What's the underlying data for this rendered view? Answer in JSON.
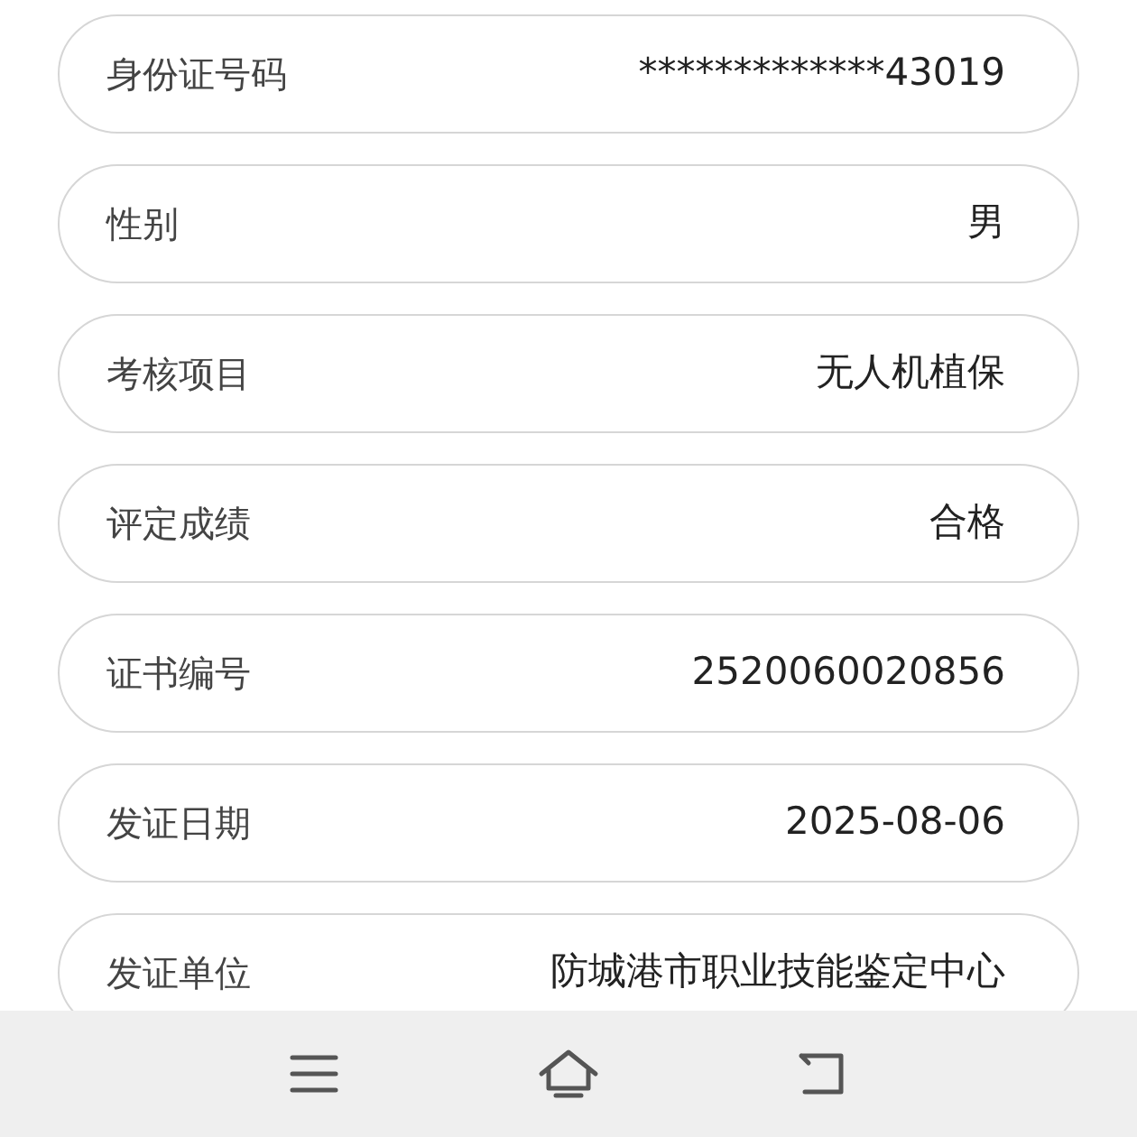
{
  "fields": [
    {
      "label": "身份证号码",
      "value": "*************43019"
    },
    {
      "label": "性别",
      "value": "男"
    },
    {
      "label": "考核项目",
      "value": "无人机植保"
    },
    {
      "label": "评定成绩",
      "value": "合格"
    },
    {
      "label": "证书编号",
      "value": "2520060020856"
    },
    {
      "label": "发证日期",
      "value": "2025-08-06"
    },
    {
      "label": "发证单位",
      "value": "防城港市职业技能鉴定中心"
    }
  ],
  "nav_bar": {
    "buttons": [
      {
        "kind": "menu"
      },
      {
        "kind": "home"
      },
      {
        "kind": "back"
      }
    ]
  }
}
